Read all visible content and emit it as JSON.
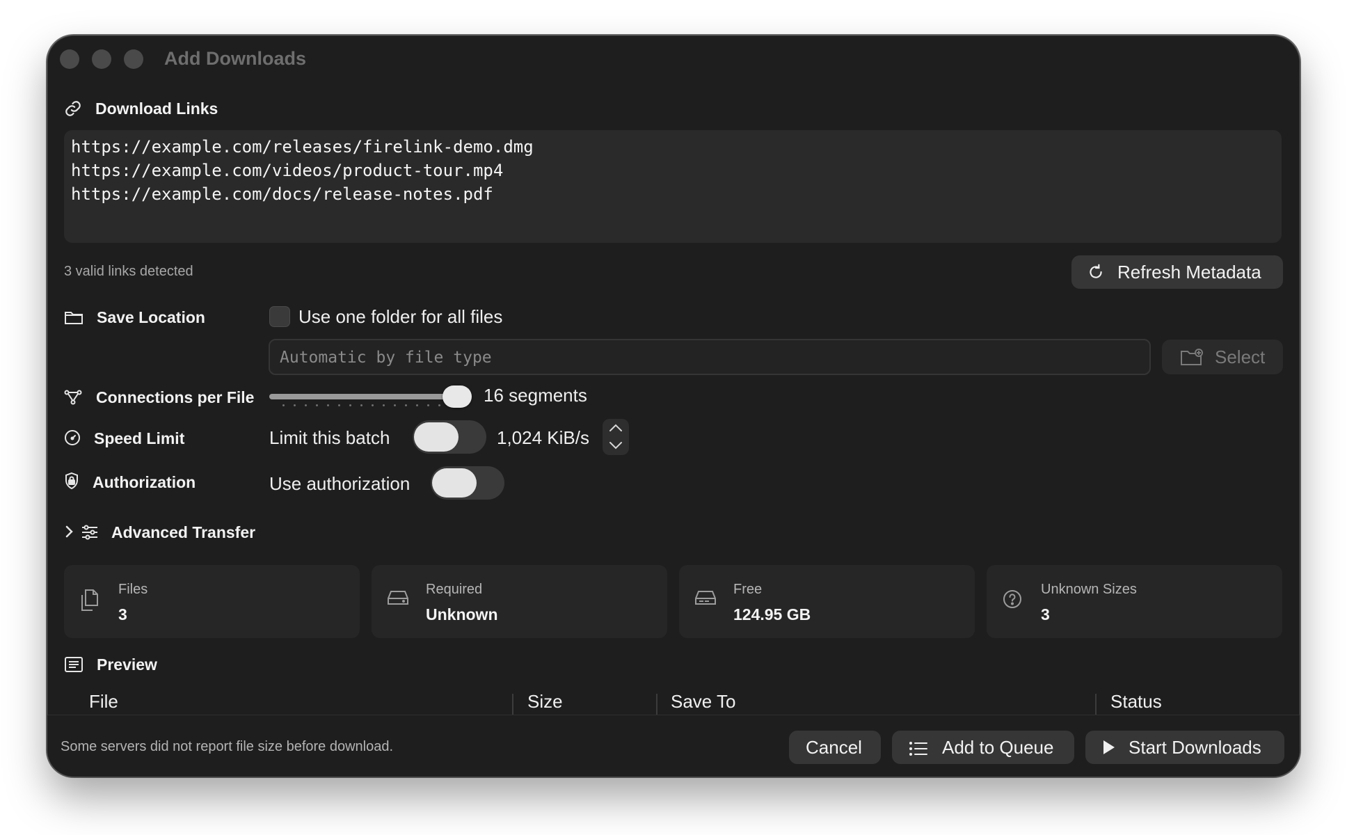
{
  "window": {
    "title": "Add Downloads"
  },
  "download_links": {
    "label": "Download Links",
    "icon": "link-icon",
    "lines": [
      "https://example.com/releases/firelink-demo.dmg",
      "https://example.com/videos/product-tour.mp4",
      "https://example.com/docs/release-notes.pdf"
    ],
    "status": "3 valid links detected",
    "refresh_button": "Refresh Metadata"
  },
  "save_location": {
    "label": "Save Location",
    "icon": "folder-icon",
    "checkbox_label": "Use one folder for all files",
    "checkbox_checked": false,
    "path_placeholder": "Automatic by file type",
    "path_value": "",
    "select_button": "Select"
  },
  "connections": {
    "label": "Connections per File",
    "icon": "network-icon",
    "value_text": "16 segments",
    "slider_fraction": 1.0
  },
  "speed_limit": {
    "label": "Speed Limit",
    "icon": "gauge-icon",
    "toggle_label": "Limit this batch",
    "toggle_on": false,
    "rate_text": "1,024 KiB/s"
  },
  "authorization": {
    "label": "Authorization",
    "icon": "shield-lock-icon",
    "toggle_label": "Use authorization",
    "toggle_on": false
  },
  "advanced": {
    "label": "Advanced Transfer",
    "icon": "sliders-icon",
    "expanded": false
  },
  "summary": [
    {
      "label": "Files",
      "value": "3",
      "icon": "documents-icon"
    },
    {
      "label": "Required",
      "value": "Unknown",
      "icon": "drive-icon"
    },
    {
      "label": "Free",
      "value": "124.95 GB",
      "icon": "drive-icon"
    },
    {
      "label": "Unknown Sizes",
      "value": "3",
      "icon": "question-circle-icon"
    }
  ],
  "preview": {
    "label": "Preview",
    "icon": "list-box-icon",
    "columns": [
      "File",
      "Size",
      "Save To",
      "Status"
    ]
  },
  "footer": {
    "note": "Some servers did not report file size before download.",
    "cancel": "Cancel",
    "add_to_queue": "Add to Queue",
    "start_downloads": "Start Downloads"
  },
  "colors": {
    "window_bg": "#1e1e1e",
    "panel_bg": "#2a2a2a",
    "text": "#ececec",
    "muted": "#a8a8a8"
  }
}
